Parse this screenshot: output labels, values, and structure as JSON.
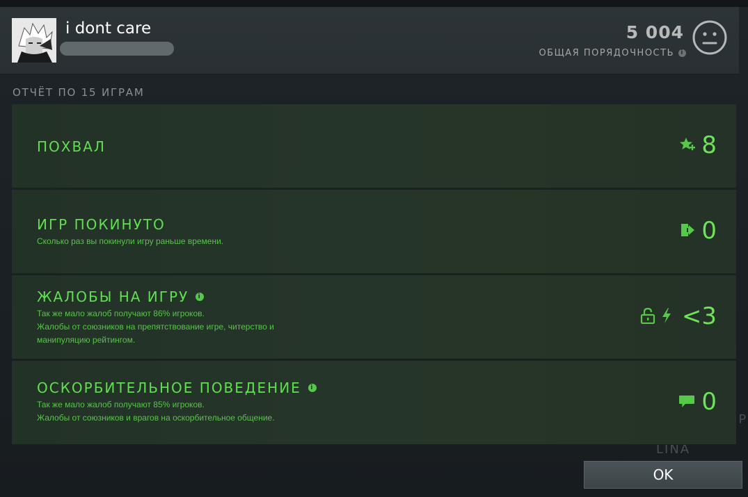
{
  "header": {
    "username": "i dont care",
    "score": "5 004",
    "score_label": "ОБЩАЯ ПОРЯДОЧНОСТЬ",
    "info_glyph": "i",
    "face_icon": "neutral-face-icon"
  },
  "report": {
    "title": "ОТЧЁТ ПО 15 ИГРАМ",
    "rows": [
      {
        "title": "ПОХВАЛ",
        "desc_lines": [],
        "value": "8",
        "icons": [
          "star-plus-icon"
        ]
      },
      {
        "title": "ИГР ПОКИНУТО",
        "desc_lines": [
          "Сколько раз вы покинули игру раньше времени."
        ],
        "value": "0",
        "icons": [
          "exit-door-icon"
        ]
      },
      {
        "title": "ЖАЛОБЫ НА ИГРУ",
        "desc_lines": [
          "Так же мало жалоб получают 86% игроков.",
          "Жалобы от союзников на препятствование игре, читерство и",
          "манипуляцию рейтингом."
        ],
        "value": "<3",
        "icons": [
          "unlocked-icon",
          "lightning-icon"
        ]
      },
      {
        "title": "ОСКОРБИТЕЛЬНОЕ ПОВЕДЕНИЕ",
        "desc_lines": [
          "Так же мало жалоб получают 85% игроков.",
          "Жалобы от союзников и врагов на оскорбительное общение."
        ],
        "value": "0",
        "icons": [
          "chat-bubble-icon"
        ]
      }
    ]
  },
  "background": {
    "lina": "LINA",
    "izbr": "ИЗБР"
  },
  "footer": {
    "ok_label": "OK"
  },
  "colors": {
    "accent_green": "#5fe04f",
    "row_bg": "#26352a",
    "header_bg": "#2d3438"
  }
}
